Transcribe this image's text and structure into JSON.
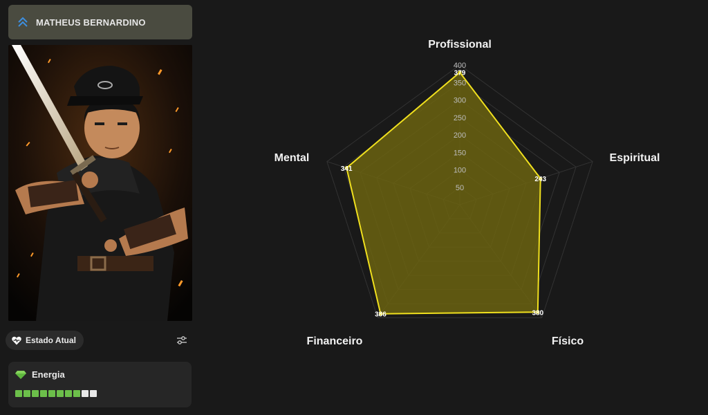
{
  "profile": {
    "name": "MATHEUS BERNARDINO"
  },
  "status": {
    "label": "Estado Atual"
  },
  "energy": {
    "label": "Energia",
    "filled": 8,
    "total": 10,
    "filled_color": "#6cbf4a",
    "empty_color": "#e8e8e8"
  },
  "colors": {
    "accent": "#f0e01e",
    "fill": "#6b6310",
    "header_bg": "#4a4b40",
    "icon_blue": "#3d8fe0"
  },
  "chart_data": {
    "type": "radar",
    "categories": [
      "Profissional",
      "Espiritual",
      "Físico",
      "Financeiro",
      "Mental"
    ],
    "values": [
      379,
      243,
      380,
      386,
      341
    ],
    "value_labels": [
      "379",
      "243",
      "380",
      "386",
      "341"
    ],
    "rlim": [
      0,
      400
    ],
    "ticks": [
      "50",
      "100",
      "150",
      "200",
      "250",
      "300",
      "350",
      "400"
    ],
    "grid": true
  }
}
